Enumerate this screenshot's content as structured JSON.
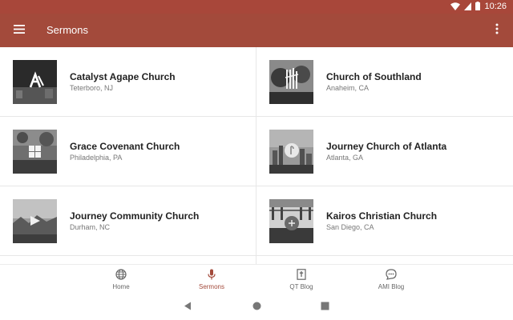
{
  "status_bar": {
    "time": "10:26",
    "icons": [
      "wifi-icon",
      "signal-icon",
      "battery-icon"
    ]
  },
  "app_bar": {
    "title": "Sermons",
    "menu_icon": "menu-icon",
    "more_icon": "more-vert-icon"
  },
  "colors": {
    "primary": "#a34a3b",
    "status_bar": "#a8473a",
    "active_nav": "#a34a3b"
  },
  "churches": [
    {
      "name": "Catalyst Agape Church",
      "location": "Teterboro, NJ"
    },
    {
      "name": "Church of Southland",
      "location": "Anaheim, CA"
    },
    {
      "name": "Grace Covenant Church",
      "location": "Philadelphia, PA"
    },
    {
      "name": "Journey Church of Atlanta",
      "location": "Atlanta, GA"
    },
    {
      "name": "Journey Community Church",
      "location": "Durham, NC"
    },
    {
      "name": "Kairos Christian Church",
      "location": "San Diego, CA"
    }
  ],
  "bottom_nav": {
    "items": [
      {
        "label": "Home",
        "icon": "globe-icon"
      },
      {
        "label": "Sermons",
        "icon": "microphone-icon",
        "active": true
      },
      {
        "label": "QT Blog",
        "icon": "bible-icon"
      },
      {
        "label": "AMI Blog",
        "icon": "chat-bubble-icon"
      }
    ]
  },
  "system_nav": {
    "icons": [
      "back-icon",
      "home-icon",
      "recents-icon"
    ]
  }
}
